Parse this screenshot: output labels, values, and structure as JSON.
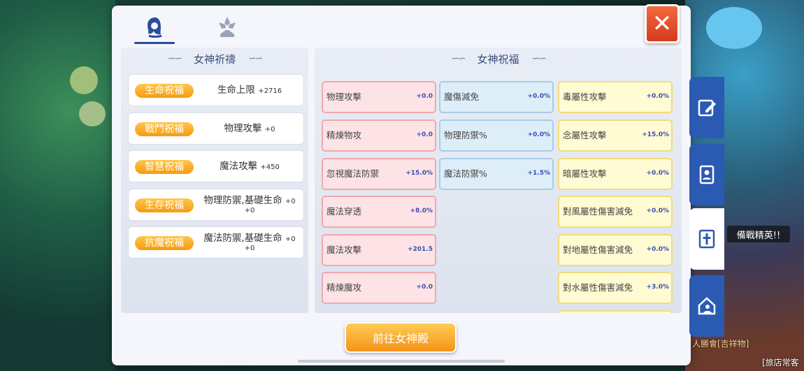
{
  "tabs": [
    {
      "icon": "goddess-portrait-icon",
      "active": true
    },
    {
      "icon": "crystal-emblem-icon",
      "active": false
    }
  ],
  "close_icon": "close-icon",
  "prayer_panel": {
    "title": "女神祈禱",
    "rows": [
      {
        "badge": "生命祝福",
        "stat": "生命上限",
        "value": "+2716"
      },
      {
        "badge": "戰鬥祝福",
        "stat": "物理攻擊",
        "value": "+0"
      },
      {
        "badge": "智慧祝福",
        "stat": "魔法攻擊",
        "value": "+450"
      },
      {
        "badge": "生存祝福",
        "stat": "物理防禦,基礎生命",
        "value": "+0",
        "value2": "+0"
      },
      {
        "badge": "抗魔祝福",
        "stat": "魔法防禦,基礎生命",
        "value": "+0",
        "value2": "+0"
      }
    ]
  },
  "blessing_panel": {
    "title": "女神祝福",
    "columns": [
      [
        {
          "label": "物理攻擊",
          "value": "+0.0"
        },
        {
          "label": "精煉物攻",
          "value": "+0.0"
        },
        {
          "label": "忽視魔法防禦",
          "value": "+15.0%"
        },
        {
          "label": "魔法穿透",
          "value": "+8.0%"
        },
        {
          "label": "魔法攻擊",
          "value": "+201.5"
        },
        {
          "label": "精煉魔攻",
          "value": "+0.0"
        }
      ],
      [
        {
          "label": "魔傷減免",
          "value": "+0.0%"
        },
        {
          "label": "物理防禦%",
          "value": "+0.0%"
        },
        {
          "label": "魔法防禦%",
          "value": "+1.5%"
        }
      ],
      [
        {
          "label": "毒屬性攻擊",
          "value": "+0.0%"
        },
        {
          "label": "念屬性攻擊",
          "value": "+15.0%"
        },
        {
          "label": "暗屬性攻擊",
          "value": "+0.0%"
        },
        {
          "label": "對風屬性傷害減免",
          "value": "+0.0%"
        },
        {
          "label": "對地屬性傷害減免",
          "value": "+0.0%"
        },
        {
          "label": "對水屬性傷害減免",
          "value": "+3.0%"
        }
      ]
    ],
    "colors": {
      "red": "#fde3e5",
      "blue": "#ddeef9",
      "yellow": "#fffbd3"
    }
  },
  "go_button": "前往女神殿",
  "side_tabs": [
    {
      "icon": "edit-icon",
      "active": false
    },
    {
      "icon": "contact-book-icon",
      "active": false
    },
    {
      "icon": "cross-book-icon",
      "active": true
    },
    {
      "icon": "guild-house-icon",
      "active": false
    }
  ],
  "game_overlay": {
    "banner": "備戰精英!!",
    "chat_1": "人勝會[吉祥物]",
    "chat_2": "[旅店常客"
  }
}
